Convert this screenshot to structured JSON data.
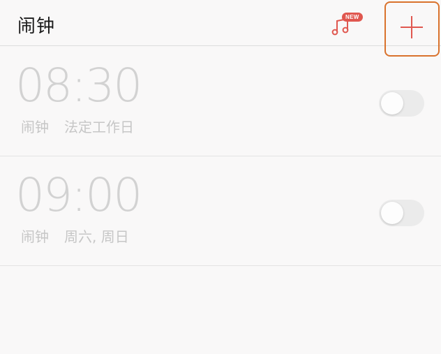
{
  "header": {
    "title": "闹钟",
    "music_badge": "NEW",
    "music_icon": "music-note-icon",
    "add_icon": "plus-icon",
    "accent": "#e0574f",
    "highlight": "#d9722c"
  },
  "alarms": [
    {
      "time": "08:30",
      "label": "闹钟",
      "repeat": "法定工作日",
      "enabled": false
    },
    {
      "time": "09:00",
      "label": "闹钟",
      "repeat": "周六, 周日",
      "enabled": false
    }
  ]
}
